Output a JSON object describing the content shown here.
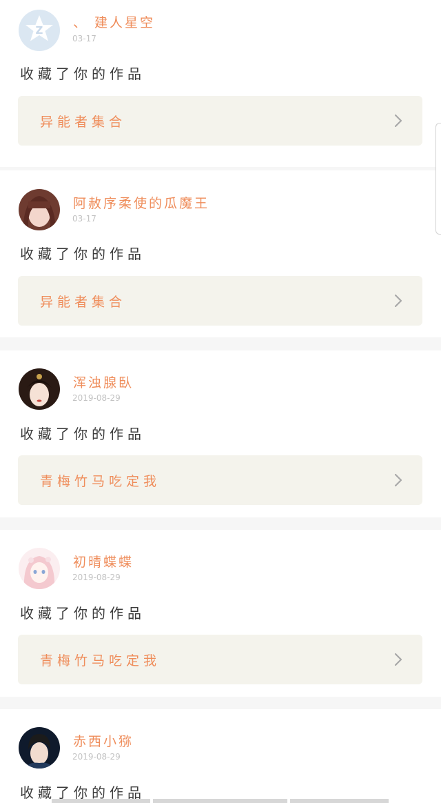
{
  "feed": {
    "items": [
      {
        "username": "、 建人星空",
        "date": "03-17",
        "action": "收藏了你的作品",
        "work_title": "异能者集合",
        "avatar": "qzone-default-avatar"
      },
      {
        "username": "阿赦序柔使的瓜魔王",
        "date": "03-17",
        "action": "收藏了你的作品",
        "work_title": "异能者集合",
        "avatar": "girl-photo-avatar"
      },
      {
        "username": "浑浊腺臥",
        "date": "2019-08-29",
        "action": "收藏了你的作品",
        "work_title": "青梅竹马吃定我",
        "avatar": "costume-woman-avatar"
      },
      {
        "username": "初晴蝶蝶",
        "date": "2019-08-29",
        "action": "收藏了你的作品",
        "work_title": "青梅竹马吃定我",
        "avatar": "anime-girl-avatar"
      },
      {
        "username": "赤西小猕",
        "date": "2019-08-29",
        "action": "收藏了你的作品",
        "work_title": "",
        "avatar": "young-man-avatar"
      }
    ]
  },
  "colors": {
    "accent": "#ef8d5b",
    "card_link_bg": "#f4f3ec",
    "separator": "#f6f6f6",
    "date_text": "#c3c3c3",
    "action_text": "#3b3b3b"
  }
}
